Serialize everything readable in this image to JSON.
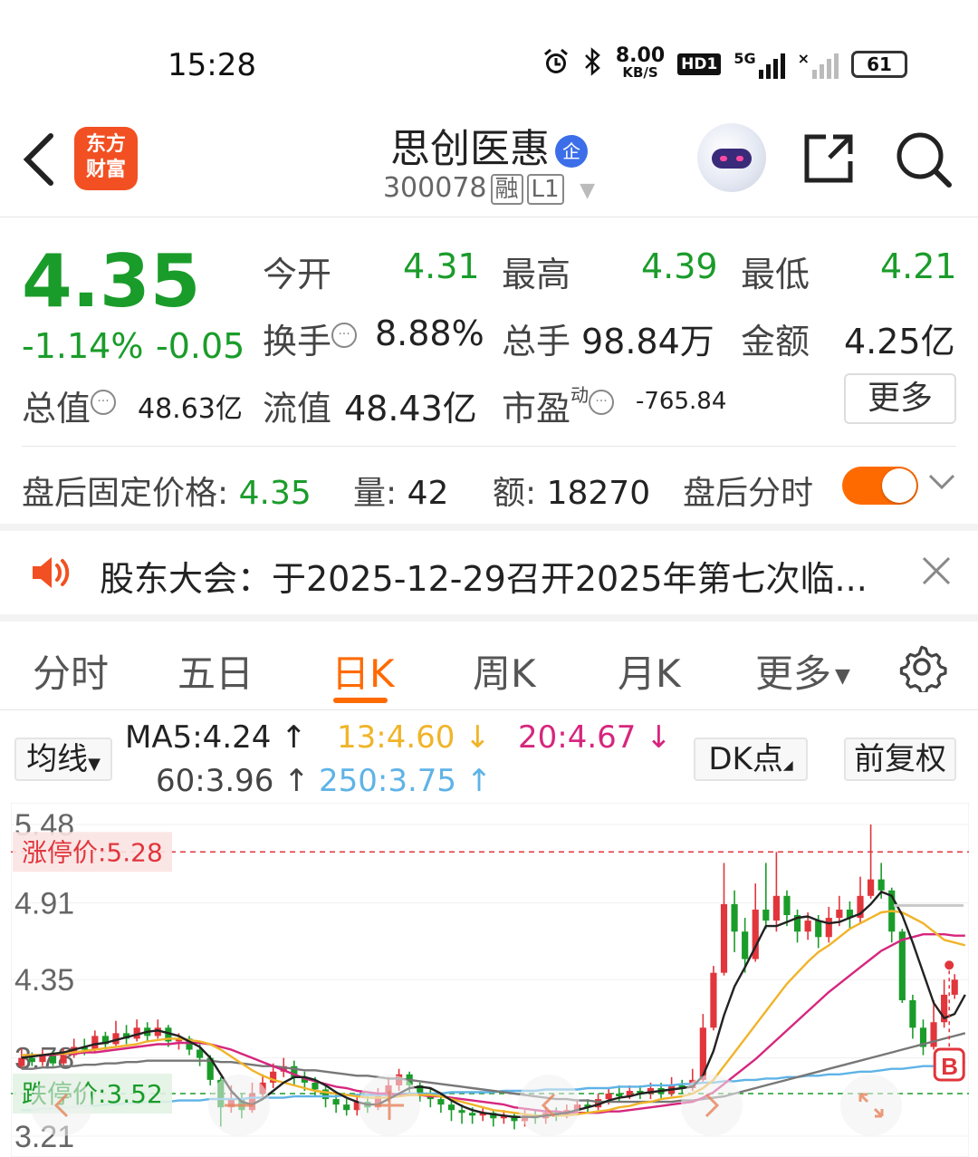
{
  "status_bar": {
    "time": "15:28",
    "net_speed_value": "8.00",
    "net_speed_unit": "KB/S",
    "hd_badge": "HD1",
    "network": "5G",
    "battery": "61",
    "icons": [
      "alarm-icon",
      "bluetooth-icon",
      "signal-icon",
      "wifi-off-icon",
      "battery-icon"
    ]
  },
  "header": {
    "logo_line1": "东方",
    "logo_line2": "财富",
    "stock_name": "思创医惠",
    "corp_badge": "企",
    "stock_code": "300078",
    "tag_margin": "融",
    "tag_level": "L1"
  },
  "quote": {
    "price": "4.35",
    "change_pct": "-1.14%",
    "change_abs": "-0.05",
    "open_label": "今开",
    "open_value": "4.31",
    "high_label": "最高",
    "high_value": "4.39",
    "low_label": "最低",
    "low_value": "4.21",
    "turnover_label": "换手",
    "turnover_value": "8.88%",
    "volume_label": "总手",
    "volume_value": "98.84万",
    "amount_label": "金额",
    "amount_value": "4.25亿",
    "mktcap_label": "总值",
    "mktcap_value": "48.63亿",
    "float_label": "流值",
    "float_value": "48.43亿",
    "pe_label": "市盈",
    "pe_sup": "动",
    "pe_value": "-765.84",
    "more_label": "更多"
  },
  "after_hours": {
    "price_label": "盘后固定价格:",
    "price_value": "4.35",
    "vol_label": "量:",
    "vol_value": "42",
    "amt_label": "额:",
    "amt_value": "18270",
    "toggle_label": "盘后分时",
    "toggle_on": true
  },
  "notice": {
    "text": "股东大会：于2025-12-29召开2025年第七次临..."
  },
  "tabs": [
    "分时",
    "五日",
    "日K",
    "周K",
    "月K",
    "更多"
  ],
  "active_tab": "日K",
  "ma_bar": {
    "type_label": "均线",
    "ma5": "MA5:4.24",
    "ma13": "13:4.60",
    "ma20": "20:4.67",
    "ma60": "60:3.96",
    "ma250": "250:3.75",
    "dk_label": "DK点",
    "adjust_label": "前复权"
  },
  "colors": {
    "up": "#e0363c",
    "down": "#1a9c2a",
    "accent": "#ff6a00",
    "ma5": "#222222",
    "ma13": "#f0b429",
    "ma20": "#d6267e",
    "ma60": "#777777",
    "ma250": "#5fb3e6"
  },
  "chart_data": {
    "type": "candlestick",
    "y_ticks": [
      "5.48",
      "4.91",
      "4.35",
      "3.78",
      "3.21"
    ],
    "ylim": [
      3.21,
      5.48
    ],
    "limit_up_label": "涨停价:5.28",
    "limit_down_label": "跌停价:3.52",
    "marker": "B",
    "candles": [
      [
        3.72,
        3.78,
        3.85,
        3.7
      ],
      [
        3.78,
        3.75,
        3.82,
        3.72
      ],
      [
        3.75,
        3.8,
        3.84,
        3.72
      ],
      [
        3.8,
        3.74,
        3.83,
        3.72
      ],
      [
        3.74,
        3.8,
        3.85,
        3.72
      ],
      [
        3.8,
        3.86,
        3.92,
        3.78
      ],
      [
        3.86,
        3.84,
        3.92,
        3.8
      ],
      [
        3.84,
        3.94,
        3.98,
        3.82
      ],
      [
        3.94,
        3.88,
        3.97,
        3.84
      ],
      [
        3.88,
        3.96,
        4.05,
        3.86
      ],
      [
        3.96,
        3.92,
        4.02,
        3.88
      ],
      [
        3.92,
        4.0,
        4.06,
        3.9
      ],
      [
        4.0,
        3.94,
        4.04,
        3.9
      ],
      [
        3.94,
        4.0,
        4.06,
        3.92
      ],
      [
        4.0,
        3.9,
        4.02,
        3.86
      ],
      [
        3.9,
        3.92,
        3.96,
        3.84
      ],
      [
        3.92,
        3.84,
        3.94,
        3.8
      ],
      [
        3.84,
        3.78,
        3.88,
        3.72
      ],
      [
        3.78,
        3.62,
        3.8,
        3.58
      ],
      [
        3.62,
        3.42,
        3.64,
        3.28
      ],
      [
        3.42,
        3.48,
        3.58,
        3.38
      ],
      [
        3.48,
        3.4,
        3.52,
        3.34
      ],
      [
        3.4,
        3.52,
        3.6,
        3.38
      ],
      [
        3.52,
        3.6,
        3.66,
        3.48
      ],
      [
        3.6,
        3.68,
        3.74,
        3.56
      ],
      [
        3.68,
        3.72,
        3.78,
        3.64
      ],
      [
        3.72,
        3.64,
        3.76,
        3.58
      ],
      [
        3.64,
        3.6,
        3.68,
        3.54
      ],
      [
        3.6,
        3.55,
        3.64,
        3.5
      ],
      [
        3.55,
        3.48,
        3.58,
        3.42
      ],
      [
        3.48,
        3.44,
        3.52,
        3.38
      ],
      [
        3.44,
        3.4,
        3.48,
        3.36
      ],
      [
        3.4,
        3.46,
        3.5,
        3.36
      ],
      [
        3.46,
        3.42,
        3.5,
        3.38
      ],
      [
        3.42,
        3.5,
        3.56,
        3.4
      ],
      [
        3.5,
        3.58,
        3.64,
        3.46
      ],
      [
        3.58,
        3.66,
        3.7,
        3.54
      ],
      [
        3.66,
        3.58,
        3.68,
        3.52
      ],
      [
        3.58,
        3.52,
        3.6,
        3.46
      ],
      [
        3.52,
        3.48,
        3.56,
        3.42
      ],
      [
        3.48,
        3.44,
        3.52,
        3.38
      ],
      [
        3.44,
        3.4,
        3.48,
        3.32
      ],
      [
        3.4,
        3.38,
        3.44,
        3.3
      ],
      [
        3.38,
        3.36,
        3.42,
        3.3
      ],
      [
        3.36,
        3.38,
        3.42,
        3.32
      ],
      [
        3.38,
        3.34,
        3.4,
        3.28
      ],
      [
        3.34,
        3.36,
        3.4,
        3.3
      ],
      [
        3.36,
        3.32,
        3.38,
        3.26
      ],
      [
        3.32,
        3.36,
        3.4,
        3.28
      ],
      [
        3.36,
        3.34,
        3.4,
        3.3
      ],
      [
        3.34,
        3.38,
        3.42,
        3.3
      ],
      [
        3.38,
        3.36,
        3.42,
        3.32
      ],
      [
        3.36,
        3.4,
        3.44,
        3.34
      ],
      [
        3.4,
        3.44,
        3.48,
        3.36
      ],
      [
        3.44,
        3.42,
        3.48,
        3.38
      ],
      [
        3.42,
        3.48,
        3.52,
        3.4
      ],
      [
        3.48,
        3.52,
        3.56,
        3.44
      ],
      [
        3.52,
        3.5,
        3.58,
        3.46
      ],
      [
        3.5,
        3.54,
        3.58,
        3.48
      ],
      [
        3.54,
        3.52,
        3.58,
        3.48
      ],
      [
        3.52,
        3.56,
        3.6,
        3.48
      ],
      [
        3.56,
        3.52,
        3.6,
        3.48
      ],
      [
        3.52,
        3.58,
        3.64,
        3.5
      ],
      [
        3.58,
        3.56,
        3.62,
        3.52
      ],
      [
        3.56,
        3.62,
        3.7,
        3.54
      ],
      [
        3.62,
        4.0,
        4.1,
        3.6
      ],
      [
        4.0,
        4.4,
        4.45,
        3.98
      ],
      [
        4.4,
        4.9,
        5.2,
        4.38
      ],
      [
        4.9,
        4.7,
        5.0,
        4.55
      ],
      [
        4.7,
        4.5,
        4.8,
        4.4
      ],
      [
        4.5,
        4.86,
        5.05,
        4.48
      ],
      [
        4.86,
        4.78,
        5.2,
        4.72
      ],
      [
        4.78,
        4.96,
        5.28,
        4.7
      ],
      [
        4.96,
        4.82,
        5.0,
        4.74
      ],
      [
        4.82,
        4.7,
        4.86,
        4.62
      ],
      [
        4.7,
        4.78,
        4.84,
        4.64
      ],
      [
        4.78,
        4.66,
        4.82,
        4.58
      ],
      [
        4.66,
        4.8,
        4.88,
        4.62
      ],
      [
        4.8,
        4.86,
        4.96,
        4.74
      ],
      [
        4.86,
        4.8,
        4.92,
        4.72
      ],
      [
        4.8,
        4.96,
        5.1,
        4.76
      ],
      [
        4.96,
        5.08,
        5.48,
        4.94
      ],
      [
        5.08,
        5.0,
        5.2,
        4.94
      ],
      [
        5.0,
        4.7,
        5.02,
        4.62
      ],
      [
        4.7,
        4.2,
        4.72,
        4.18
      ],
      [
        4.2,
        4.0,
        4.24,
        3.92
      ],
      [
        4.0,
        3.86,
        4.06,
        3.8
      ],
      [
        3.86,
        4.04,
        4.2,
        3.84
      ],
      [
        4.04,
        4.24,
        4.35,
        4.0
      ],
      [
        4.24,
        4.35,
        4.39,
        4.21
      ]
    ],
    "ma5": [
      3.78,
      3.79,
      3.8,
      3.81,
      3.82,
      3.84,
      3.86,
      3.88,
      3.89,
      3.91,
      3.93,
      3.95,
      3.97,
      3.98,
      3.96,
      3.94,
      3.9,
      3.86,
      3.78,
      3.66,
      3.54,
      3.46,
      3.44,
      3.48,
      3.54,
      3.6,
      3.64,
      3.64,
      3.62,
      3.58,
      3.53,
      3.49,
      3.46,
      3.44,
      3.44,
      3.48,
      3.52,
      3.56,
      3.57,
      3.56,
      3.52,
      3.47,
      3.43,
      3.4,
      3.38,
      3.37,
      3.36,
      3.35,
      3.35,
      3.35,
      3.36,
      3.37,
      3.38,
      3.4,
      3.42,
      3.44,
      3.47,
      3.49,
      3.5,
      3.52,
      3.53,
      3.54,
      3.55,
      3.56,
      3.57,
      3.65,
      3.83,
      4.09,
      4.3,
      4.44,
      4.59,
      4.74,
      4.74,
      4.77,
      4.8,
      4.81,
      4.78,
      4.76,
      4.77,
      4.8,
      4.83,
      4.9,
      4.99,
      4.96,
      4.82,
      4.62,
      4.4,
      4.18,
      4.07,
      4.1,
      4.24
    ],
    "ma13": [
      3.8,
      3.8,
      3.8,
      3.81,
      3.81,
      3.82,
      3.83,
      3.84,
      3.85,
      3.86,
      3.87,
      3.88,
      3.9,
      3.91,
      3.92,
      3.92,
      3.91,
      3.9,
      3.88,
      3.84,
      3.79,
      3.74,
      3.69,
      3.65,
      3.62,
      3.6,
      3.58,
      3.56,
      3.54,
      3.53,
      3.52,
      3.51,
      3.5,
      3.49,
      3.49,
      3.49,
      3.5,
      3.51,
      3.51,
      3.51,
      3.5,
      3.48,
      3.46,
      3.44,
      3.42,
      3.4,
      3.39,
      3.38,
      3.37,
      3.36,
      3.36,
      3.36,
      3.36,
      3.37,
      3.38,
      3.39,
      3.4,
      3.42,
      3.43,
      3.45,
      3.46,
      3.48,
      3.49,
      3.5,
      3.52,
      3.56,
      3.62,
      3.72,
      3.82,
      3.92,
      4.02,
      4.12,
      4.22,
      4.32,
      4.4,
      4.48,
      4.55,
      4.6,
      4.66,
      4.72,
      4.76,
      4.8,
      4.84,
      4.85,
      4.84,
      4.8,
      4.76,
      4.7,
      4.64,
      4.62,
      4.6
    ],
    "ma20": [
      3.8,
      3.8,
      3.8,
      3.8,
      3.81,
      3.81,
      3.82,
      3.82,
      3.83,
      3.84,
      3.85,
      3.86,
      3.87,
      3.88,
      3.88,
      3.89,
      3.89,
      3.89,
      3.88,
      3.86,
      3.84,
      3.81,
      3.78,
      3.75,
      3.72,
      3.69,
      3.66,
      3.63,
      3.61,
      3.59,
      3.57,
      3.56,
      3.54,
      3.53,
      3.52,
      3.52,
      3.51,
      3.51,
      3.51,
      3.5,
      3.5,
      3.49,
      3.48,
      3.47,
      3.46,
      3.45,
      3.44,
      3.42,
      3.41,
      3.4,
      3.39,
      3.39,
      3.38,
      3.38,
      3.38,
      3.38,
      3.39,
      3.39,
      3.4,
      3.41,
      3.42,
      3.43,
      3.44,
      3.45,
      3.46,
      3.49,
      3.53,
      3.59,
      3.65,
      3.71,
      3.77,
      3.84,
      3.91,
      3.98,
      4.05,
      4.12,
      4.19,
      4.26,
      4.32,
      4.38,
      4.44,
      4.5,
      4.56,
      4.6,
      4.64,
      4.66,
      4.68,
      4.68,
      4.68,
      4.67,
      4.67
    ],
    "ma60": [
      3.7,
      3.7,
      3.71,
      3.71,
      3.72,
      3.72,
      3.73,
      3.73,
      3.74,
      3.74,
      3.75,
      3.75,
      3.76,
      3.76,
      3.76,
      3.76,
      3.76,
      3.76,
      3.76,
      3.75,
      3.75,
      3.74,
      3.73,
      3.72,
      3.72,
      3.71,
      3.7,
      3.69,
      3.69,
      3.68,
      3.67,
      3.66,
      3.65,
      3.65,
      3.64,
      3.63,
      3.63,
      3.62,
      3.61,
      3.6,
      3.59,
      3.58,
      3.57,
      3.56,
      3.55,
      3.54,
      3.53,
      3.52,
      3.51,
      3.5,
      3.49,
      3.48,
      3.48,
      3.47,
      3.47,
      3.46,
      3.46,
      3.46,
      3.46,
      3.46,
      3.46,
      3.46,
      3.46,
      3.47,
      3.47,
      3.48,
      3.49,
      3.5,
      3.52,
      3.54,
      3.56,
      3.58,
      3.6,
      3.62,
      3.64,
      3.66,
      3.68,
      3.7,
      3.72,
      3.74,
      3.76,
      3.78,
      3.8,
      3.82,
      3.84,
      3.86,
      3.88,
      3.9,
      3.92,
      3.94,
      3.96
    ],
    "ma250": [
      3.4,
      3.4,
      3.41,
      3.41,
      3.42,
      3.42,
      3.43,
      3.43,
      3.44,
      3.44,
      3.45,
      3.45,
      3.46,
      3.46,
      3.46,
      3.47,
      3.47,
      3.47,
      3.48,
      3.48,
      3.48,
      3.48,
      3.49,
      3.49,
      3.49,
      3.49,
      3.5,
      3.5,
      3.5,
      3.5,
      3.5,
      3.51,
      3.51,
      3.51,
      3.51,
      3.51,
      3.52,
      3.52,
      3.52,
      3.52,
      3.52,
      3.53,
      3.53,
      3.53,
      3.53,
      3.53,
      3.54,
      3.54,
      3.54,
      3.54,
      3.55,
      3.55,
      3.55,
      3.55,
      3.56,
      3.56,
      3.56,
      3.57,
      3.57,
      3.57,
      3.58,
      3.58,
      3.58,
      3.59,
      3.59,
      3.6,
      3.6,
      3.61,
      3.61,
      3.62,
      3.62,
      3.63,
      3.63,
      3.64,
      3.64,
      3.65,
      3.65,
      3.66,
      3.66,
      3.67,
      3.68,
      3.68,
      3.69,
      3.7,
      3.7,
      3.71,
      3.72,
      3.72,
      3.73,
      3.74,
      3.75
    ]
  }
}
